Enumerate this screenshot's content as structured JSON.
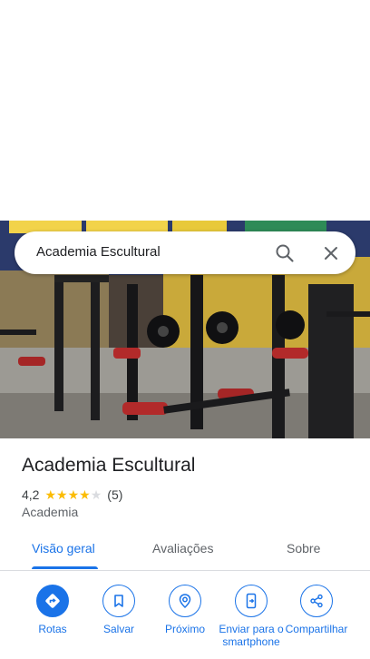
{
  "search": {
    "query": "Academia Escultural"
  },
  "place": {
    "name": "Academia Escultural",
    "rating": "4,2",
    "rating_value": 4.2,
    "review_count": "(5)",
    "category": "Academia"
  },
  "tabs": [
    {
      "label": "Visão geral",
      "active": true
    },
    {
      "label": "Avaliações",
      "active": false
    },
    {
      "label": "Sobre",
      "active": false
    }
  ],
  "actions": [
    {
      "label": "Rotas",
      "icon": "directions-icon"
    },
    {
      "label": "Salvar",
      "icon": "bookmark-icon"
    },
    {
      "label": "Próximo",
      "icon": "nearby-icon"
    },
    {
      "label": "Enviar para o smartphone",
      "icon": "send-to-phone-icon"
    },
    {
      "label": "Compartilhar",
      "icon": "share-icon"
    }
  ],
  "colors": {
    "accent": "#1a73e8",
    "star": "#fbbc04",
    "star_empty": "#dadce0"
  }
}
